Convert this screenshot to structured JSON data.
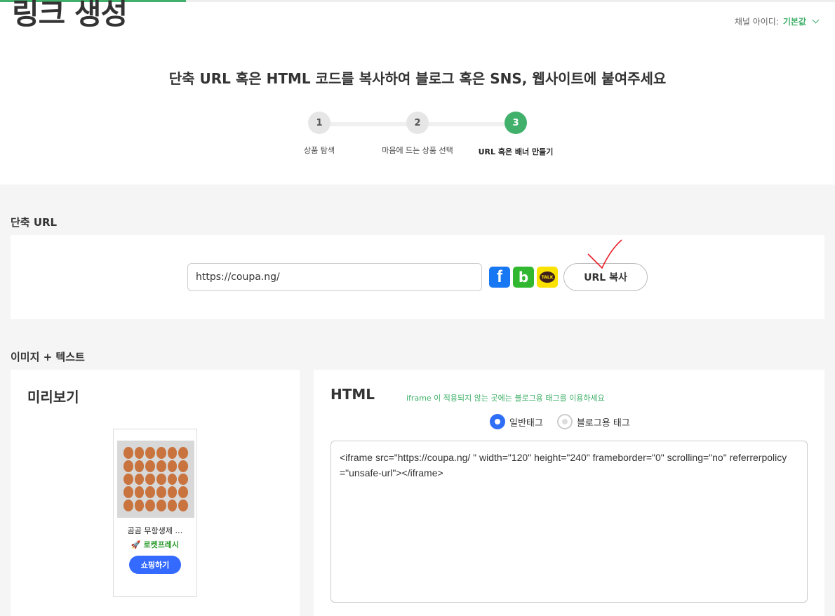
{
  "page": {
    "title": "링크 생성",
    "channel_label": "채널 아이디:",
    "channel_value": "기본값",
    "headline": "단축 URL 혹은 HTML 코드를 복사하여 블로그 혹은 SNS, 웹사이트에 붙여주세요"
  },
  "steps": [
    {
      "num": "1",
      "label": "상품 탐색"
    },
    {
      "num": "2",
      "label": "마음에 드는 상품 선택"
    },
    {
      "num": "3",
      "label": "URL 혹은 배너 만들기"
    }
  ],
  "short_url": {
    "section_title": "단축 URL",
    "value": "https://coupa.ng/",
    "copy_label": "URL 복사",
    "sns": {
      "facebook": "f",
      "band": "b",
      "kakao": "TALK"
    }
  },
  "image_text": {
    "section_title": "이미지 + 텍스트",
    "preview_title": "미리보기",
    "product_name": "곰곰 무항생제 …",
    "rocket_label": "🚀 로켓프레시",
    "shop_label": "쇼핑하기",
    "html_title": "HTML",
    "hint": "iframe 이 적용되지 않는 곳에는 블로그용 태그를 이용하세요",
    "radio_normal": "일반태그",
    "radio_blog": "블로그용 태그",
    "code": "<iframe src=\"https://coupa.ng/          \" width=\"120\" height=\"240\" frameborder=\"0\" scrolling=\"no\" referrerpolicy=\"unsafe-url\"></iframe>"
  },
  "colors": {
    "accent": "#41b06a",
    "primary_blue": "#346aff",
    "facebook": "#1877f2",
    "band": "#31b830",
    "kakao": "#fae100"
  }
}
